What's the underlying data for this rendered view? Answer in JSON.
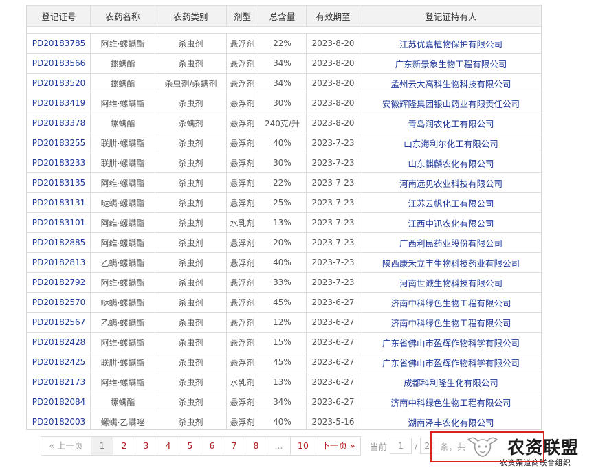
{
  "table": {
    "headers": [
      "登记证号",
      "农药名称",
      "农药类别",
      "剂型",
      "总含量",
      "有效期至",
      "登记证持有人"
    ],
    "rows": [
      [
        "PD20183785",
        "阿维·螺螨酯",
        "杀虫剂",
        "悬浮剂",
        "22%",
        "2023-8-20",
        "江苏优嘉植物保护有限公司"
      ],
      [
        "PD20183566",
        "螺螨酯",
        "杀虫剂",
        "悬浮剂",
        "34%",
        "2023-8-20",
        "广东新景象生物工程有限公司"
      ],
      [
        "PD20183520",
        "螺螨酯",
        "杀虫剂/杀螨剂",
        "悬浮剂",
        "34%",
        "2023-8-20",
        "孟州云大高科生物科技有限公司"
      ],
      [
        "PD20183419",
        "阿维·螺螨酯",
        "杀虫剂",
        "悬浮剂",
        "30%",
        "2023-8-20",
        "安徽辉隆集团银山药业有限责任公司"
      ],
      [
        "PD20183378",
        "螺螨酯",
        "杀螨剂",
        "悬浮剂",
        "240克/升",
        "2023-8-20",
        "青岛润农化工有限公司"
      ],
      [
        "PD20183255",
        "联肼·螺螨酯",
        "杀虫剂",
        "悬浮剂",
        "40%",
        "2023-7-23",
        "山东海利尔化工有限公司"
      ],
      [
        "PD20183233",
        "联肼·螺螨酯",
        "杀虫剂",
        "悬浮剂",
        "30%",
        "2023-7-23",
        "山东麒麟农化有限公司"
      ],
      [
        "PD20183135",
        "阿维·螺螨酯",
        "杀虫剂",
        "悬浮剂",
        "22%",
        "2023-7-23",
        "河南远见农业科技有限公司"
      ],
      [
        "PD20183131",
        "哒螨·螺螨酯",
        "杀虫剂",
        "悬浮剂",
        "25%",
        "2023-7-23",
        "江苏云帆化工有限公司"
      ],
      [
        "PD20183101",
        "阿维·螺螨酯",
        "杀虫剂",
        "水乳剂",
        "13%",
        "2023-7-23",
        "江西中迅农化有限公司"
      ],
      [
        "PD20182885",
        "阿维·螺螨酯",
        "杀虫剂",
        "悬浮剂",
        "20%",
        "2023-7-23",
        "广西利民药业股份有限公司"
      ],
      [
        "PD20182813",
        "乙螨·螺螨酯",
        "杀虫剂",
        "悬浮剂",
        "40%",
        "2023-7-23",
        "陕西康禾立丰生物科技药业有限公司"
      ],
      [
        "PD20182792",
        "阿维·螺螨酯",
        "杀虫剂",
        "悬浮剂",
        "33%",
        "2023-7-23",
        "河南世诚生物科技有限公司"
      ],
      [
        "PD20182570",
        "哒螨·螺螨酯",
        "杀虫剂",
        "悬浮剂",
        "45%",
        "2023-6-27",
        "济南中科绿色生物工程有限公司"
      ],
      [
        "PD20182567",
        "乙螨·螺螨酯",
        "杀虫剂",
        "悬浮剂",
        "12%",
        "2023-6-27",
        "济南中科绿色生物工程有限公司"
      ],
      [
        "PD20182428",
        "阿维·螺螨酯",
        "杀虫剂",
        "悬浮剂",
        "15%",
        "2023-6-27",
        "广东省佛山市盈辉作物科学有限公司"
      ],
      [
        "PD20182425",
        "联肼·螺螨酯",
        "杀虫剂",
        "悬浮剂",
        "45%",
        "2023-6-27",
        "广东省佛山市盈辉作物科学有限公司"
      ],
      [
        "PD20182173",
        "阿维·螺螨酯",
        "杀虫剂",
        "水乳剂",
        "13%",
        "2023-6-27",
        "成都科利隆生化有限公司"
      ],
      [
        "PD20182084",
        "螺螨酯",
        "杀虫剂",
        "悬浮剂",
        "34%",
        "2023-6-27",
        "济南中科绿色生物工程有限公司"
      ],
      [
        "PD20182003",
        "螺螨·乙螨唑",
        "杀虫剂",
        "悬浮剂",
        "40%",
        "2023-5-16",
        "湖南泽丰农化有限公司"
      ]
    ]
  },
  "pagination": {
    "prev": "« 上一页",
    "pages": [
      "1",
      "2",
      "3",
      "4",
      "5",
      "6",
      "7",
      "8",
      "...",
      "10"
    ],
    "current": "1",
    "next": "下一页 »",
    "current_label": "当前",
    "current_value": "1",
    "separator": "/",
    "total_value": "20",
    "partial_text": "条，共"
  },
  "watermark": {
    "title": "农资联盟",
    "subtitle": "农资渠道商联合组织"
  },
  "colors": {
    "link": "#1f3a9a",
    "pager_link": "#b32020",
    "highlight_box": "#d9231f"
  }
}
